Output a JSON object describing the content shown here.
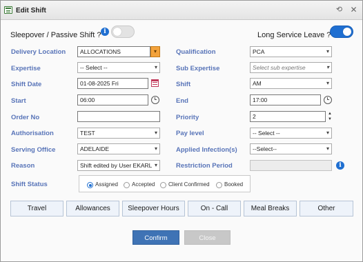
{
  "window": {
    "title": "Edit Shift"
  },
  "toggles": {
    "sleepover_label": "Sleepover / Passive Shift ?",
    "long_service_label": "Long Service Leave ?"
  },
  "form": {
    "delivery_location": {
      "label": "Delivery Location",
      "value": "ALLOCATIONS"
    },
    "qualification": {
      "label": "Qualification",
      "value": "PCA"
    },
    "expertise": {
      "label": "Expertise",
      "value": "-- Select --"
    },
    "sub_expertise": {
      "label": "Sub Expertise",
      "placeholder": "Select sub expertise"
    },
    "shift_date": {
      "label": "Shift Date",
      "value": "01-08-2025 Fri"
    },
    "shift": {
      "label": "Shift",
      "value": "AM"
    },
    "start": {
      "label": "Start",
      "value": "06:00"
    },
    "end": {
      "label": "End",
      "value": "17:00"
    },
    "order_no": {
      "label": "Order No",
      "value": ""
    },
    "priority": {
      "label": "Priority",
      "value": "2"
    },
    "authorisation": {
      "label": "Authorisation",
      "value": "TEST"
    },
    "pay_level": {
      "label": "Pay level",
      "value": "-- Select --"
    },
    "serving_office": {
      "label": "Serving Office",
      "value": "ADELAIDE"
    },
    "applied_infections": {
      "label": "Applied Infection(s)",
      "value": "--Select--"
    },
    "reason": {
      "label": "Reason",
      "value": "Shift edited by User EKARL"
    },
    "restriction_period": {
      "label": "Restriction Period",
      "value": ""
    }
  },
  "shift_status": {
    "label": "Shift Status",
    "options": [
      "Assigned",
      "Accepted",
      "Client Confirmed",
      "Booked"
    ],
    "selected": "Assigned"
  },
  "tabs": [
    "Travel",
    "Allowances",
    "Sleepover Hours",
    "On - Call",
    "Meal Breaks",
    "Other"
  ],
  "buttons": {
    "confirm": "Confirm",
    "close": "Close"
  },
  "state": {
    "sleepover_on": false,
    "long_service_on": true
  },
  "colors": {
    "accent": "#1f6fd1",
    "label": "#5874b8",
    "confirm": "#3f73b5",
    "dropdown_highlight": "#f3a23b"
  }
}
